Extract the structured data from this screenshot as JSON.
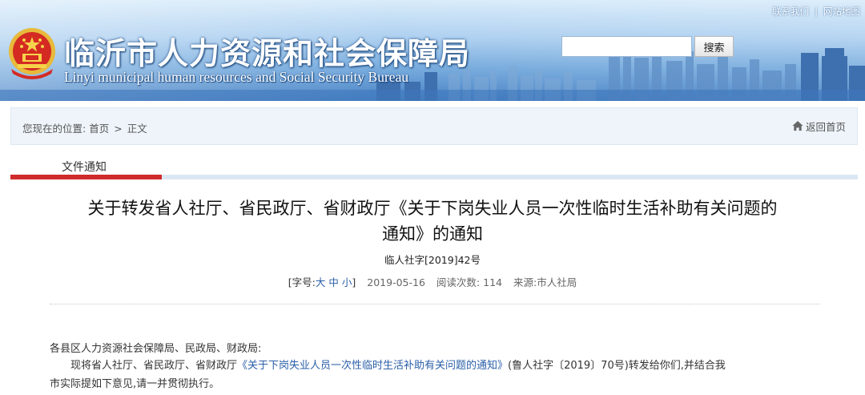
{
  "header": {
    "title": "临沂市人力资源和社会保障局",
    "subtitle": "Linyi municipal human resources and Social Security Bureau",
    "top_links": [
      "联系我们",
      "网站地图"
    ],
    "top_links_separator": "|",
    "search": {
      "value": "",
      "button_label": "搜索"
    },
    "emblem_icon": "national-emblem-icon"
  },
  "breadcrumb": {
    "prefix": "您现在的位置:",
    "home": "首页",
    "separator": ">",
    "current": "正文",
    "back_home_label": "返回首页",
    "back_home_icon": "home-icon"
  },
  "section_tab": {
    "label": "文件通知",
    "accent_color": "#d02b2b"
  },
  "article": {
    "title_line1": "关于转发省人社厅、省民政厅、省财政厅《关于下岗失业人员一次性临时生活补助有关问题的",
    "title_line2": "通知》的通知",
    "doc_number": "临人社字[2019]42号",
    "meta": {
      "font_size_prefix": "[字号:",
      "size_large": "大",
      "size_medium": "中",
      "size_small": "小",
      "font_size_suffix": "]",
      "date": "2019-05-16",
      "reads_label": "阅读次数:",
      "reads": "114",
      "source_label": "来源:",
      "source": "市人社局"
    },
    "salutation": "各县区人力资源社会保障局、民政局、财政局:",
    "para1_start": "现将省人社厅、省民政厅、省财政厅",
    "para1_link": "《关于下岗失业人员一次性临时生活补助有关问题的通知》",
    "para1_rest": "(鲁人社字〔2019〕70号)转发给你们,并结合我",
    "para1_line2": "市实际提如下意见,请一并贯彻执行。",
    "link_color": "#2b5fa8"
  }
}
